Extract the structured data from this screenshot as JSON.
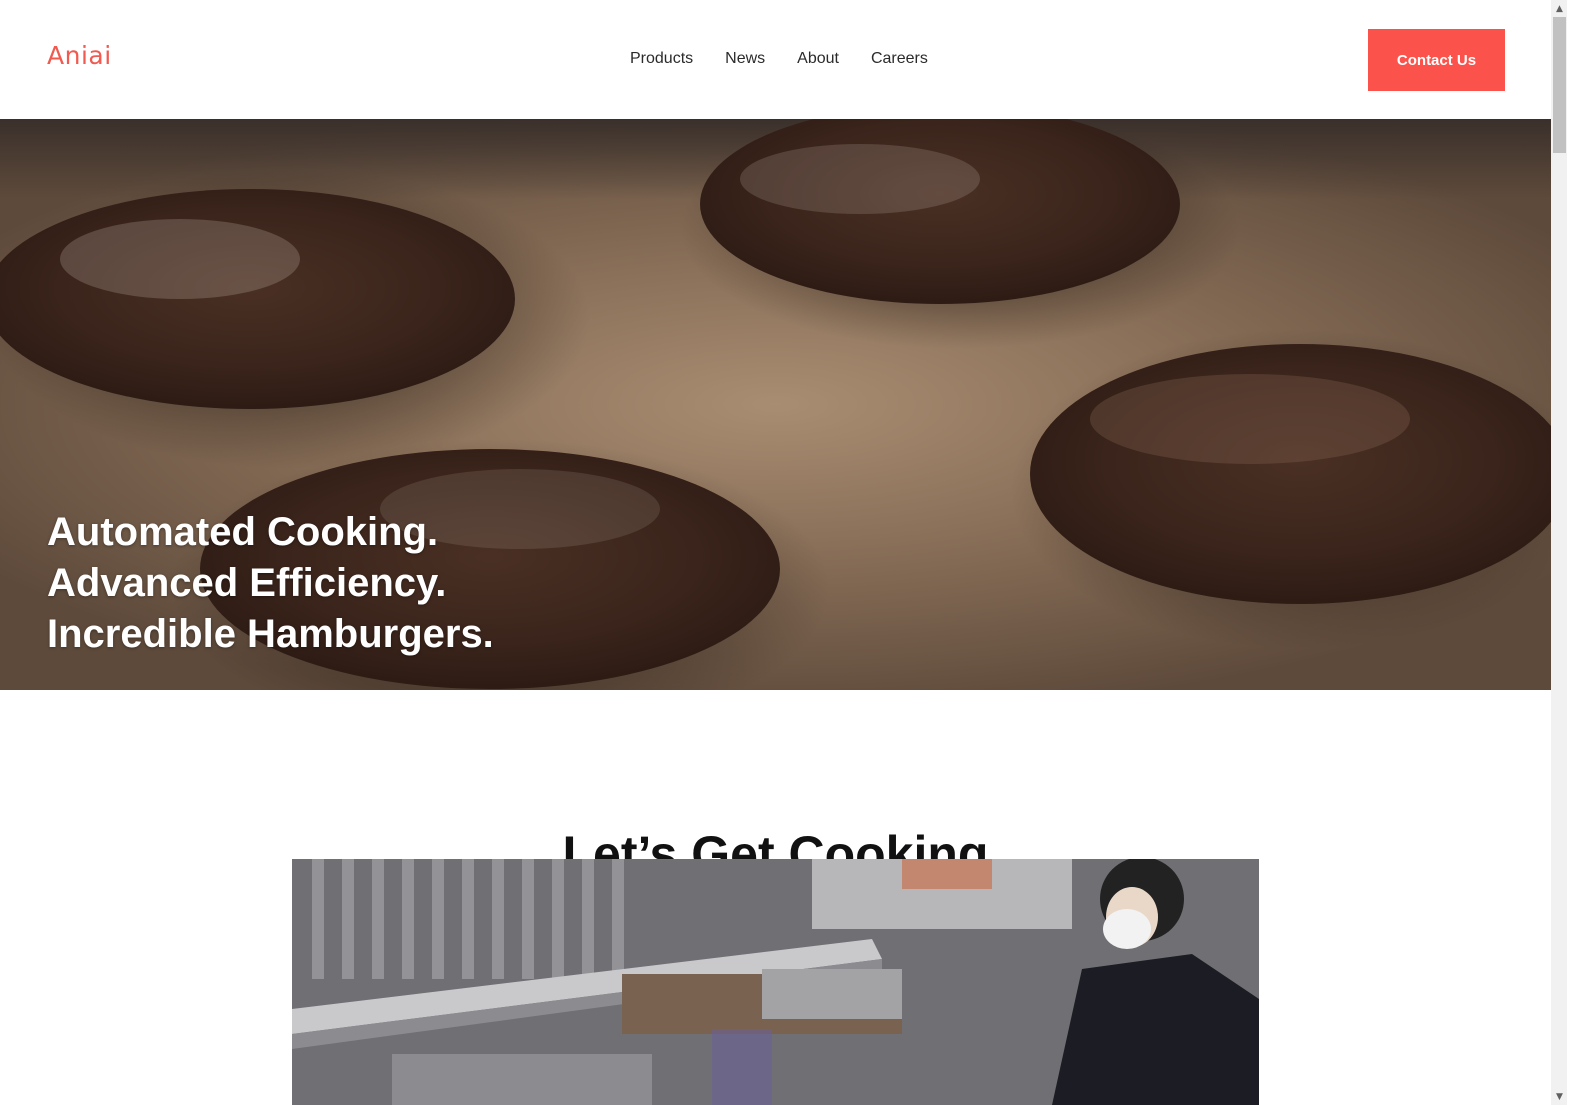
{
  "header": {
    "logo_text": "Aniai",
    "nav": {
      "products": "Products",
      "news": "News",
      "about": "About",
      "careers": "Careers"
    },
    "contact_label": "Contact Us",
    "accent_color": "#fb534b"
  },
  "hero": {
    "lines": [
      "Automated Cooking.",
      "Advanced Efficiency.",
      "Incredible Hamburgers."
    ],
    "image": "grilling-patties-photo"
  },
  "section": {
    "title": "Let’s Get Cooking",
    "image": "kitchen-robot-photo"
  },
  "scrollbar": {
    "up_icon": "scroll-up-arrow-icon",
    "down_icon": "scroll-down-arrow-icon"
  }
}
